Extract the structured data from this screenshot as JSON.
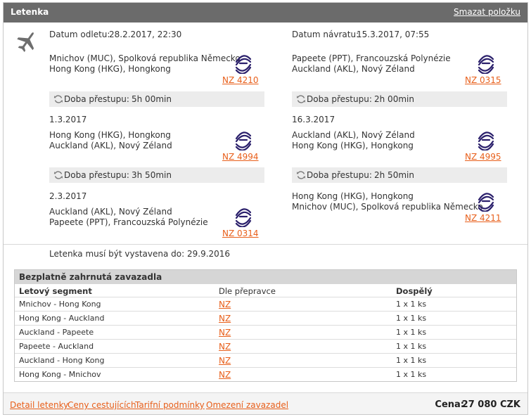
{
  "header": {
    "title": "Letenka",
    "delete_link": "Smazat položku"
  },
  "outbound": {
    "date_label": "Datum odletu:",
    "date_value": "28.2.2017, 22:30",
    "segments": [
      {
        "from": "Mnichov (MUC), Spolková republika Německo",
        "to": "Hong Kong (HKG), Hongkong",
        "flight": "NZ 4210"
      },
      {
        "date": "1.3.2017",
        "from": "Hong Kong (HKG), Hongkong",
        "to": "Auckland (AKL), Nový Zéland",
        "flight": "NZ 4994"
      },
      {
        "date": "2.3.2017",
        "from": "Auckland (AKL), Nový Zéland",
        "to": "Papeete (PPT), Francouzská Polynézie",
        "flight": "NZ 0314"
      }
    ],
    "transfers": [
      {
        "label": "Doba přestupu:",
        "value": "5h 00min"
      },
      {
        "label": "Doba přestupu:",
        "value": "3h 50min"
      }
    ]
  },
  "inbound": {
    "date_label": "Datum návratu:",
    "date_value": "15.3.2017, 07:55",
    "segments": [
      {
        "from": "Papeete (PPT), Francouzská Polynézie",
        "to": "Auckland (AKL), Nový Zéland",
        "flight": "NZ 0315"
      },
      {
        "date": "16.3.2017",
        "from": "Auckland (AKL), Nový Zéland",
        "to": "Hong Kong (HKG), Hongkong",
        "flight": "NZ 4995"
      },
      {
        "from": "Hong Kong (HKG), Hongkong",
        "to": "Mnichov (MUC), Spolková republika Německo",
        "flight": "NZ 4211"
      }
    ],
    "transfers": [
      {
        "label": "Doba přestupu:",
        "value": "2h 00min"
      },
      {
        "label": "Doba přestupu:",
        "value": "2h 50min"
      }
    ]
  },
  "issue_note": "Letenka musí být vystavena do: 29.9.2016",
  "baggage": {
    "title": "Bezplatně zahrnutá zavazadla",
    "headers": {
      "segment": "Letový segment",
      "carrier": "Dle přepravce",
      "adult": "Dospělý"
    },
    "rows": [
      {
        "segment": "Mnichov - Hong Kong",
        "carrier": "NZ",
        "adult": "1 x 1 ks"
      },
      {
        "segment": "Hong Kong - Auckland",
        "carrier": "NZ",
        "adult": "1 x 1 ks"
      },
      {
        "segment": "Auckland - Papeete",
        "carrier": "NZ",
        "adult": "1 x 1 ks"
      },
      {
        "segment": "Papeete - Auckland",
        "carrier": "NZ",
        "adult": "1 x 1 ks"
      },
      {
        "segment": "Auckland - Hong Kong",
        "carrier": "NZ",
        "adult": "1 x 1 ks"
      },
      {
        "segment": "Hong Kong - Mnichov",
        "carrier": "NZ",
        "adult": "1 x 1 ks"
      }
    ]
  },
  "footer": {
    "links": [
      "Detail letenky",
      "Ceny cestujících",
      "Tarifní podmínky",
      "Omezení zavazadel"
    ],
    "price_label": "Cena:",
    "price_value": "27 080 CZK"
  },
  "icons": {
    "plane": "airplane-icon",
    "airline": "air-new-zealand-logo-icon",
    "transfer": "transfer-cycle-icon"
  },
  "colors": {
    "header_bg": "#6b6b6b",
    "link": "#e85f1a",
    "airline_logo": "#2a1f6b",
    "transfer_bg": "#ececec"
  }
}
